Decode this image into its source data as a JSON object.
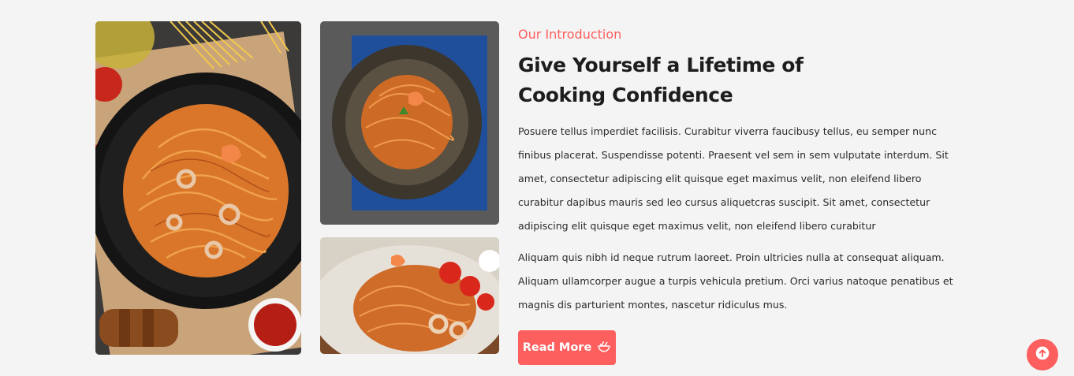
{
  "intro": {
    "eyebrow": "Our Introduction",
    "heading_line1": "Give Yourself a Lifetime of",
    "heading_line2": "Cooking Confidence",
    "paragraph1": "Posuere tellus imperdiet facilisis. Curabitur viverra faucibusy tellus, eu semper nunc finibus placerat. Suspendisse potenti. Praesent vel sem in sem vulputate interdum. Sit amet, consectetur adipiscing elit quisque eget maximus velit, non eleifend libero curabitur dapibus mauris sed leo cursus aliquetcras suscipit. Sit amet, consectetur adipiscing elit quisque eget maximus velit, non eleifend libero curabitur",
    "paragraph2": "Aliquam quis nibh id neque rutrum laoreet. Proin ultricies nulla at consequat aliquam. Aliquam ullamcorper augue a turpis vehicula pretium. Orci varius natoque penatibus et magnis dis parturient montes, nascetur ridiculus mus."
  },
  "button": {
    "read_more_label": "Read More",
    "icon": "food-bowl-icon"
  },
  "back_to_top": {
    "icon": "arrow-up-circle-icon"
  },
  "colors": {
    "accent": "#fd5e5e",
    "background": "#f4f4f4",
    "heading": "#1d1d1d",
    "body_text": "#2a2a2a"
  }
}
